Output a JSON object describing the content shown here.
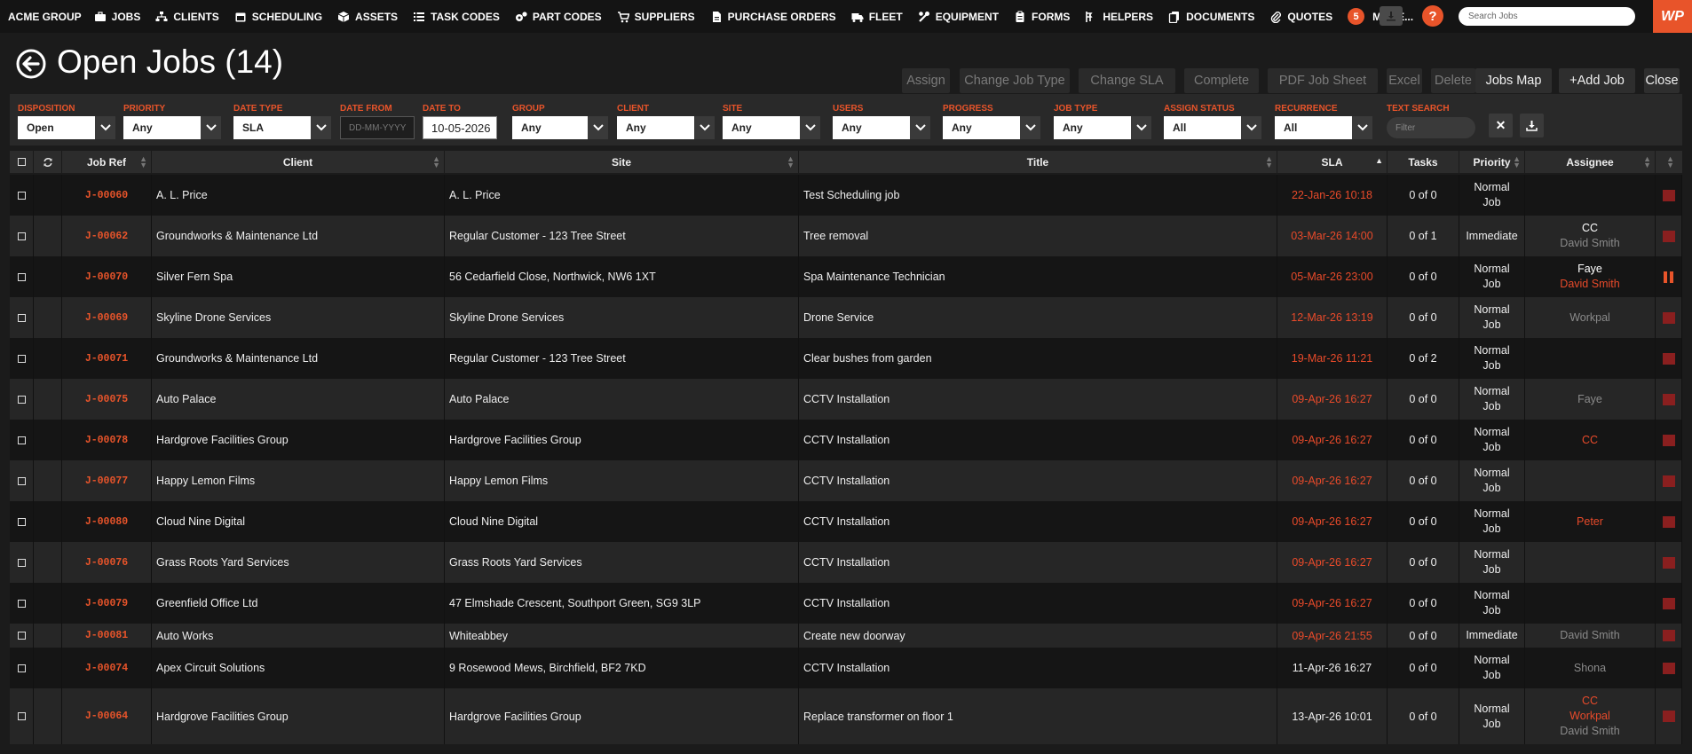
{
  "nav": {
    "brand": "ACME GROUP",
    "items": [
      {
        "label": "JOBS",
        "icon": "briefcase-icon"
      },
      {
        "label": "CLIENTS",
        "icon": "sitemap-icon"
      },
      {
        "label": "SCHEDULING",
        "icon": "calendar-icon"
      },
      {
        "label": "ASSETS",
        "icon": "cube-icon"
      },
      {
        "label": "TASK CODES",
        "icon": "list-icon"
      },
      {
        "label": "PART CODES",
        "icon": "cogs-icon"
      },
      {
        "label": "SUPPLIERS",
        "icon": "cart-icon"
      },
      {
        "label": "PURCHASE ORDERS",
        "icon": "file-icon"
      },
      {
        "label": "FLEET",
        "icon": "truck-icon"
      },
      {
        "label": "EQUIPMENT",
        "icon": "wrench-icon"
      },
      {
        "label": "FORMS",
        "icon": "clipboard-icon"
      },
      {
        "label": "HELPERS",
        "icon": "helpers-icon"
      },
      {
        "label": "DOCUMENTS",
        "icon": "copy-icon"
      },
      {
        "label": "QUOTES",
        "icon": "paperclip-icon"
      }
    ],
    "more_count": "5",
    "more_label": "MORE...",
    "help_label": "?",
    "search_placeholder": "Search Jobs",
    "logo": "WP"
  },
  "header": {
    "title": "Open Jobs (14)"
  },
  "toolbar": {
    "buttons": [
      {
        "label": "Assign",
        "active": false
      },
      {
        "label": "Change Job Type",
        "active": false
      },
      {
        "label": "Change SLA",
        "active": false
      },
      {
        "label": "Complete",
        "active": false
      },
      {
        "label": "PDF Job Sheet",
        "active": false
      },
      {
        "label": "Excel",
        "active": false
      },
      {
        "label": "Delete",
        "active": false
      },
      {
        "label": "Jobs Map",
        "active": true
      },
      {
        "label": "+Add Job",
        "active": true
      },
      {
        "label": "Close",
        "active": true
      }
    ]
  },
  "filters": {
    "disposition": {
      "label": "DISPOSITION",
      "value": "Open"
    },
    "priority": {
      "label": "PRIORITY",
      "value": "Any"
    },
    "date_type": {
      "label": "DATE TYPE",
      "value": "SLA"
    },
    "date_from": {
      "label": "DATE FROM",
      "placeholder": "DD-MM-YYYY"
    },
    "date_to": {
      "label": "DATE TO",
      "value": "10-05-2026"
    },
    "group": {
      "label": "GROUP",
      "value": "Any"
    },
    "client": {
      "label": "CLIENT",
      "value": "Any"
    },
    "site": {
      "label": "SITE",
      "value": "Any"
    },
    "users": {
      "label": "USERS",
      "value": "Any"
    },
    "progress": {
      "label": "PROGRESS",
      "value": "Any"
    },
    "job_type": {
      "label": "JOB TYPE",
      "value": "Any"
    },
    "assign_status": {
      "label": "ASSIGN STATUS",
      "value": "All"
    },
    "recurrence": {
      "label": "RECURRENCE",
      "value": "All"
    },
    "text_search": {
      "label": "TEXT SEARCH",
      "placeholder": "Filter"
    },
    "clear_label": "✕"
  },
  "table": {
    "columns": {
      "jobref": "Job Ref",
      "client": "Client",
      "site": "Site",
      "title": "Title",
      "sla": "SLA",
      "tasks": "Tasks",
      "priority": "Priority",
      "assignee": "Assignee"
    },
    "rows": [
      {
        "ref": "J-00060",
        "client": "A. L. Price",
        "site": "A. L. Price",
        "title": "Test Scheduling job",
        "sla": "22-Jan-26 10:18",
        "sla_overdue": true,
        "tasks": "0 of 0",
        "priority": [
          "Normal",
          "Job"
        ],
        "assignee": [],
        "status": "flag"
      },
      {
        "ref": "J-00062",
        "client": "Groundworks & Maintenance Ltd",
        "site": "Regular Customer - 123 Tree Street",
        "title": "Tree removal",
        "sla": "03-Mar-26 14:00",
        "sla_overdue": true,
        "tasks": "0 of 1",
        "priority": [
          "Immediate"
        ],
        "assignee": [
          {
            "t": "CC",
            "c": "white"
          },
          {
            "t": "David Smith",
            "c": "grey"
          }
        ],
        "status": "flag"
      },
      {
        "ref": "J-00070",
        "client": "Silver Fern Spa",
        "site": "56 Cedarfield Close, Northwick, NW6 1XT",
        "title": "Spa Maintenance Technician",
        "sla": "05-Mar-26 23:00",
        "sla_overdue": true,
        "tasks": "0 of 0",
        "priority": [
          "Normal",
          "Job"
        ],
        "assignee": [
          {
            "t": "Faye",
            "c": "white"
          },
          {
            "t": "David Smith",
            "c": "orange"
          }
        ],
        "status": "paused"
      },
      {
        "ref": "J-00069",
        "client": "Skyline Drone Services",
        "site": "Skyline Drone Services",
        "title": "Drone Service",
        "sla": "12-Mar-26 13:19",
        "sla_overdue": true,
        "tasks": "0 of 0",
        "priority": [
          "Normal",
          "Job"
        ],
        "assignee": [
          {
            "t": "Workpal",
            "c": "grey"
          }
        ],
        "status": "flag"
      },
      {
        "ref": "J-00071",
        "client": "Groundworks & Maintenance Ltd",
        "site": "Regular Customer - 123 Tree Street",
        "title": "Clear bushes from garden",
        "sla": "19-Mar-26 11:21",
        "sla_overdue": true,
        "tasks": "0 of 2",
        "priority": [
          "Normal",
          "Job"
        ],
        "assignee": [],
        "status": "flag"
      },
      {
        "ref": "J-00075",
        "client": "Auto Palace",
        "site": "Auto Palace",
        "title": "CCTV Installation",
        "sla": "09-Apr-26 16:27",
        "sla_overdue": true,
        "tasks": "0 of 0",
        "priority": [
          "Normal",
          "Job"
        ],
        "assignee": [
          {
            "t": "Faye",
            "c": "grey"
          }
        ],
        "status": "flag"
      },
      {
        "ref": "J-00078",
        "client": "Hardgrove Facilities Group",
        "site": "Hardgrove Facilities Group",
        "title": "CCTV Installation",
        "sla": "09-Apr-26 16:27",
        "sla_overdue": true,
        "tasks": "0 of 0",
        "priority": [
          "Normal",
          "Job"
        ],
        "assignee": [
          {
            "t": "CC",
            "c": "orange"
          }
        ],
        "status": "flag"
      },
      {
        "ref": "J-00077",
        "client": "Happy Lemon Films",
        "site": "Happy Lemon Films",
        "title": "CCTV Installation",
        "sla": "09-Apr-26 16:27",
        "sla_overdue": true,
        "tasks": "0 of 0",
        "priority": [
          "Normal",
          "Job"
        ],
        "assignee": [],
        "status": "flag"
      },
      {
        "ref": "J-00080",
        "client": "Cloud Nine Digital",
        "site": "Cloud Nine Digital",
        "title": "CCTV Installation",
        "sla": "09-Apr-26 16:27",
        "sla_overdue": true,
        "tasks": "0 of 0",
        "priority": [
          "Normal",
          "Job"
        ],
        "assignee": [
          {
            "t": "Peter",
            "c": "orange"
          }
        ],
        "status": "flag"
      },
      {
        "ref": "J-00076",
        "client": "Grass Roots Yard Services",
        "site": "Grass Roots Yard Services",
        "title": "CCTV Installation",
        "sla": "09-Apr-26 16:27",
        "sla_overdue": true,
        "tasks": "0 of 0",
        "priority": [
          "Normal",
          "Job"
        ],
        "assignee": [],
        "status": "flag"
      },
      {
        "ref": "J-00079",
        "client": "Greenfield Office Ltd",
        "site": "47 Elmshade Crescent, Southport Green, SG9 3LP",
        "title": "CCTV Installation",
        "sla": "09-Apr-26 16:27",
        "sla_overdue": true,
        "tasks": "0 of 0",
        "priority": [
          "Normal",
          "Job"
        ],
        "assignee": [],
        "status": "flag"
      },
      {
        "ref": "J-00081",
        "client": "Auto Works",
        "site": "Whiteabbey",
        "title": "Create new doorway",
        "sla": "09-Apr-26 21:55",
        "sla_overdue": true,
        "tasks": "0 of 0",
        "priority": [
          "Immediate"
        ],
        "assignee": [
          {
            "t": "David Smith",
            "c": "grey"
          }
        ],
        "status": "flag"
      },
      {
        "ref": "J-00074",
        "client": "Apex Circuit Solutions",
        "site": "9 Rosewood Mews, Birchfield, BF2 7KD",
        "title": "CCTV Installation",
        "sla": "11-Apr-26 16:27",
        "sla_overdue": false,
        "tasks": "0 of 0",
        "priority": [
          "Normal",
          "Job"
        ],
        "assignee": [
          {
            "t": "Shona",
            "c": "grey"
          }
        ],
        "status": "flag"
      },
      {
        "ref": "J-00064",
        "client": "Hardgrove Facilities Group",
        "site": "Hardgrove Facilities Group",
        "title": "Replace transformer on floor 1",
        "sla": "13-Apr-26 10:01",
        "sla_overdue": false,
        "tasks": "0 of 0",
        "priority": [
          "Normal",
          "Job"
        ],
        "assignee": [
          {
            "t": "CC",
            "c": "orange"
          },
          {
            "t": "Workpal",
            "c": "orange"
          },
          {
            "t": "David Smith",
            "c": "grey"
          }
        ],
        "status": "flag"
      }
    ]
  },
  "colors": {
    "accent": "#e8542a",
    "background": "#1b1b1b",
    "row_dark": "#151515",
    "row_light": "#262626",
    "status_flag": "#8a1f1f"
  }
}
